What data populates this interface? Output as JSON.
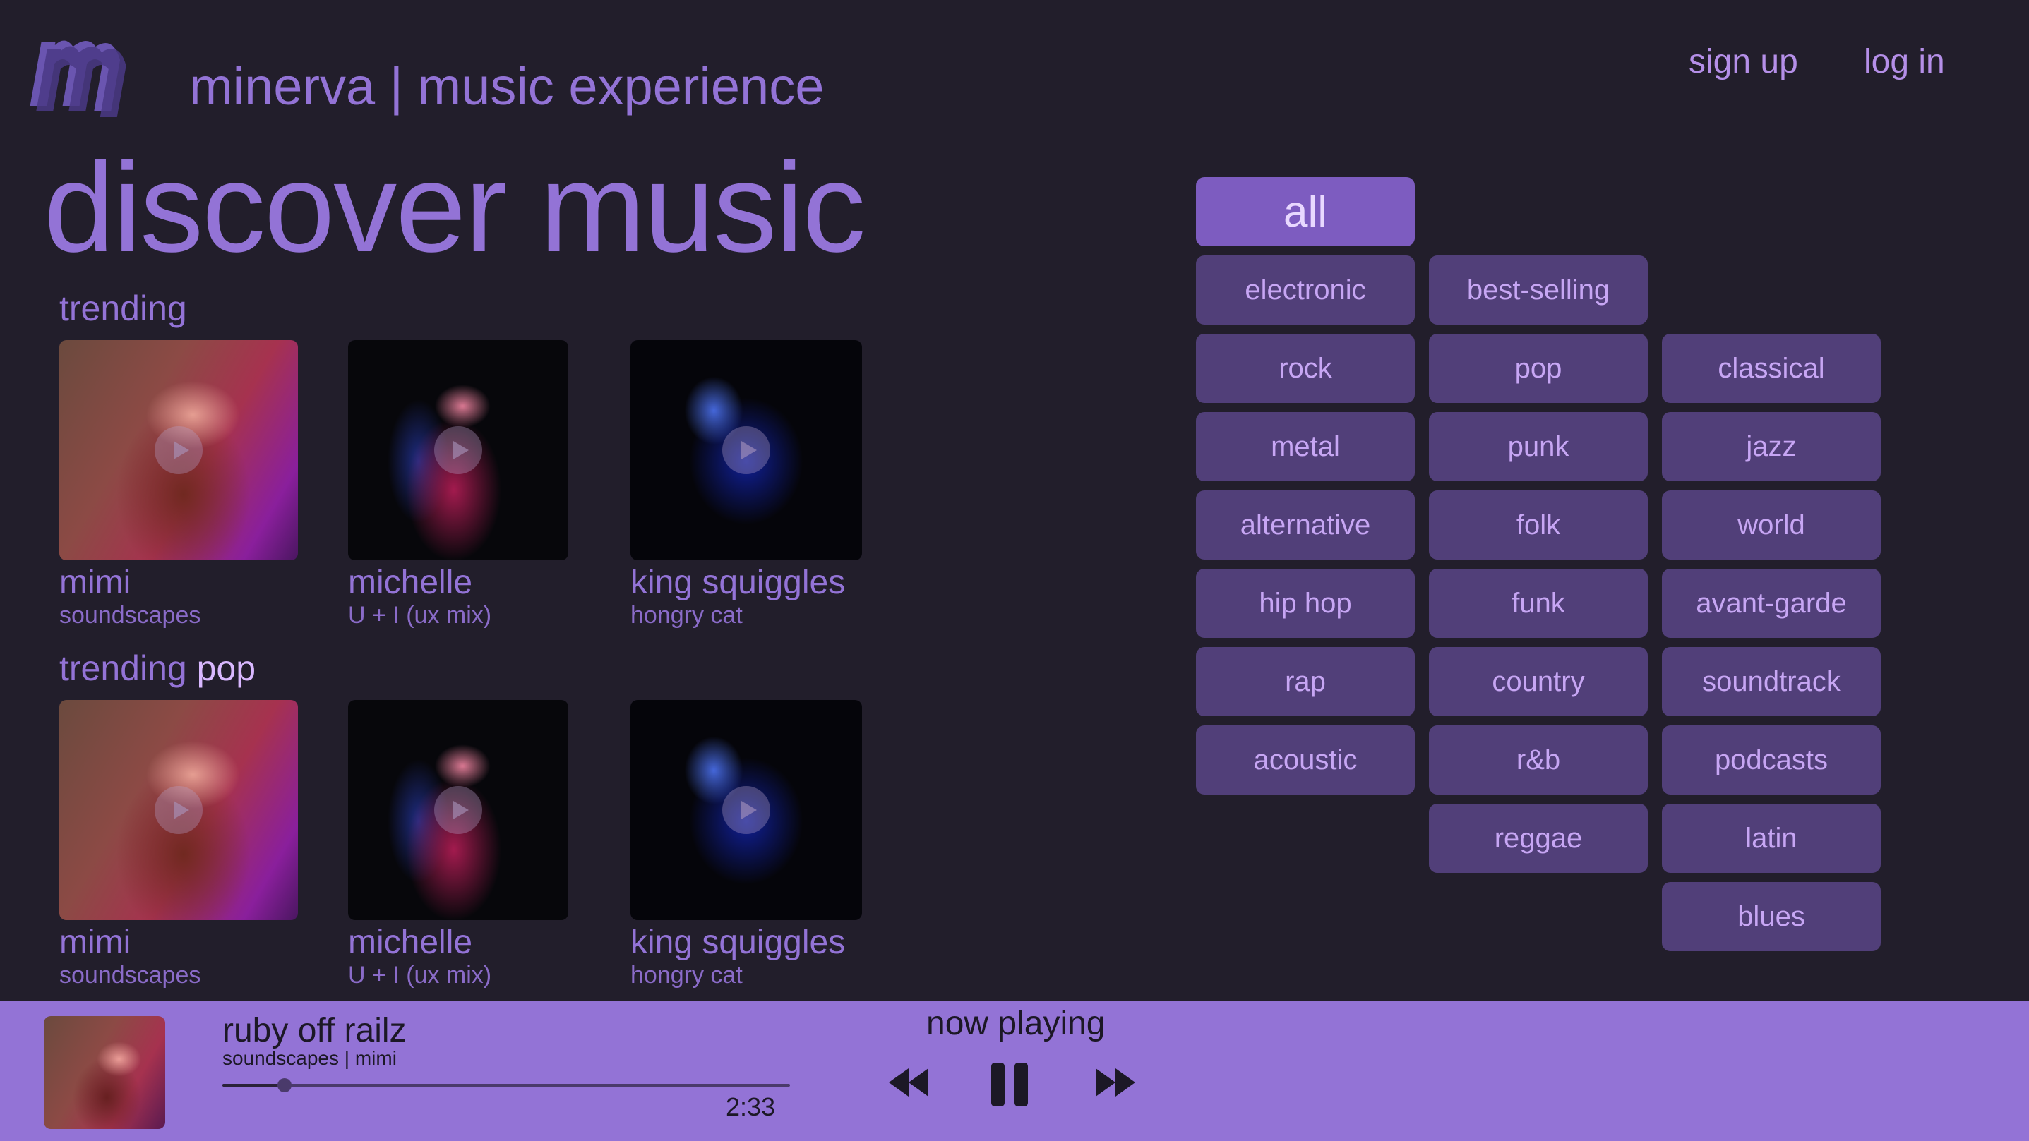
{
  "header": {
    "brand_title": "minerva | music experience",
    "sign_up": "sign up",
    "log_in": "log in"
  },
  "page_title": "discover music",
  "sections": {
    "trending": {
      "label": "trending"
    },
    "trending_pop": {
      "label": "trending",
      "accent": "pop"
    }
  },
  "cards": [
    {
      "artist": "mimi",
      "track": "soundscapes"
    },
    {
      "artist": "michelle",
      "track": "U + I (ux mix)"
    },
    {
      "artist": "king squiggles",
      "track": "hongry cat"
    }
  ],
  "genres": {
    "all": "all",
    "col1": [
      "electronic",
      "rock",
      "metal",
      "alternative",
      "hip hop",
      "rap",
      "acoustic"
    ],
    "col2": [
      "best-selling",
      "pop",
      "punk",
      "folk",
      "funk",
      "country",
      "r&b",
      "reggae"
    ],
    "col3": [
      "classical",
      "jazz",
      "world",
      "avant-garde",
      "soundtrack",
      "podcasts",
      "latin",
      "blues"
    ]
  },
  "player": {
    "title": "ruby off railz",
    "subtitle": "soundscapes | mimi",
    "time": "2:33",
    "now_playing": "now playing",
    "progress": 0.11
  },
  "colors": {
    "background": "#221e2b",
    "accent": "#9373d6",
    "genre_button": "#513f79",
    "genre_active": "#7d5cc0",
    "player_bar": "#9373d6"
  },
  "icons": {
    "logo": "minerva-m-logo",
    "play": "play-icon",
    "rewind": "rewind-icon",
    "pause": "pause-icon",
    "forward": "fast-forward-icon"
  }
}
